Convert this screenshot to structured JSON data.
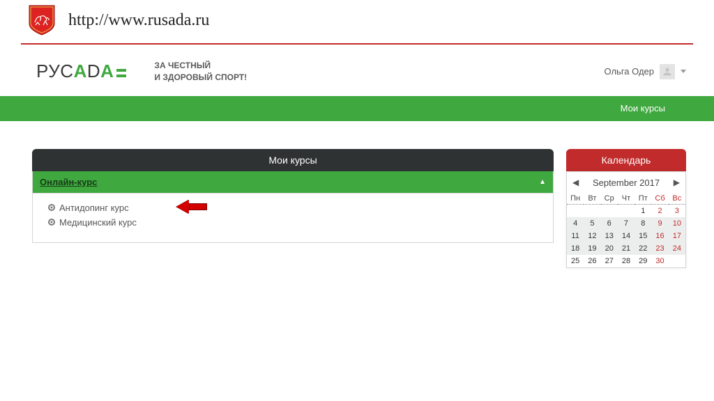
{
  "url": "http://www.rusada.ru",
  "logo": {
    "part1": "РУС",
    "part2": "А",
    "part3": "D",
    "part4": "А"
  },
  "slogan_line1": "ЗА ЧЕСТНЫЙ",
  "slogan_line2": "И ЗДОРОВЫЙ СПОРТ!",
  "user_name": "Ольга Одер",
  "nav_item": "Мои курсы",
  "panel_title": "Мои курсы",
  "section_title": "Онлайн-курс",
  "courses": [
    "Антидопинг курс",
    "Медицинский курс"
  ],
  "calendar": {
    "header": "Календарь",
    "month": "September 2017",
    "dows": [
      "Пн",
      "Вт",
      "Ср",
      "Чт",
      "Пт",
      "Сб",
      "Вс"
    ],
    "weeks": [
      [
        null,
        null,
        null,
        null,
        1,
        2,
        3
      ],
      [
        4,
        5,
        6,
        7,
        8,
        9,
        10
      ],
      [
        11,
        12,
        13,
        14,
        15,
        16,
        17
      ],
      [
        18,
        19,
        20,
        21,
        22,
        23,
        24
      ],
      [
        25,
        26,
        27,
        28,
        29,
        30,
        null
      ]
    ]
  }
}
